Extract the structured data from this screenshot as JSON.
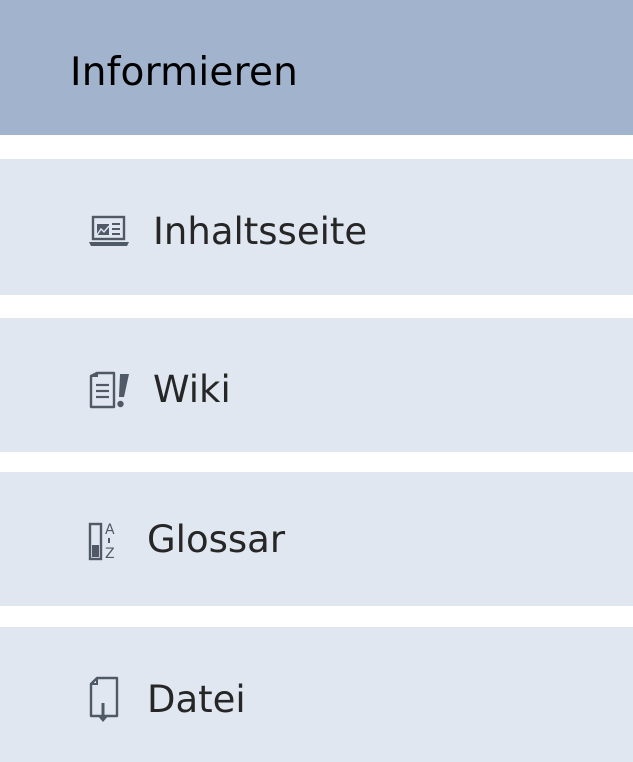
{
  "section": {
    "title": "Informieren"
  },
  "items": [
    {
      "label": "Inhaltsseite",
      "icon": "content-page-icon"
    },
    {
      "label": "Wiki",
      "icon": "wiki-icon"
    },
    {
      "label": "Glossar",
      "icon": "glossary-icon"
    },
    {
      "label": "Datei",
      "icon": "file-icon"
    }
  ],
  "colors": {
    "header_bg": "#a1b3cd",
    "item_bg": "#e1e7f0",
    "icon": "#4f5a66",
    "text": "#262626"
  }
}
